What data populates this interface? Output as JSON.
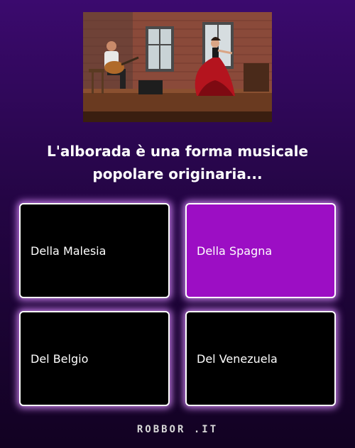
{
  "question": {
    "line1": "L'alborada è una forma musicale",
    "line2": "popolare originaria..."
  },
  "answers": [
    {
      "label": "Della Malesia",
      "selected": false
    },
    {
      "label": "Della Spagna",
      "selected": true
    },
    {
      "label": "Del Belgio",
      "selected": false
    },
    {
      "label": "Del Venezuela",
      "selected": false
    }
  ],
  "footer": {
    "brand": "ROBBOR .IT"
  },
  "colors": {
    "selected": "#9c0ec4",
    "background_top": "#3b0a6e",
    "background_bottom": "#120222"
  }
}
